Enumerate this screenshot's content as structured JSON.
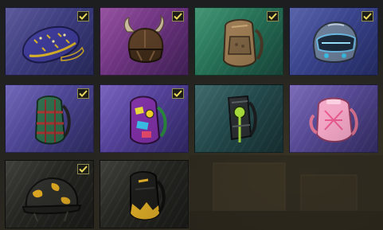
{
  "inventory": {
    "items": [
      {
        "name": "starry-cap",
        "selected": true,
        "bg": [
          "#4a4890",
          "#2d2f6a"
        ],
        "accent": "#d8b32a"
      },
      {
        "name": "horned-helmet",
        "selected": true,
        "bg": [
          "#8a3f95",
          "#4c2666"
        ],
        "accent": "#6a4a2c"
      },
      {
        "name": "tan-backpack",
        "selected": true,
        "bg": [
          "#2f8a66",
          "#1b5244"
        ],
        "accent": "#a4835a"
      },
      {
        "name": "visor-helmet",
        "selected": true,
        "bg": [
          "#4552a0",
          "#2a3274"
        ],
        "accent": "#6ab6e0"
      },
      {
        "name": "plaid-backpack",
        "selected": true,
        "bg": [
          "#6257b2",
          "#33306e"
        ],
        "accent": "#2e6b4a"
      },
      {
        "name": "sticker-backpack",
        "selected": true,
        "bg": [
          "#6a52b6",
          "#362c72"
        ],
        "accent": "#7d2fa2"
      },
      {
        "name": "frame-backpack",
        "selected": false,
        "bg": [
          "#2b5a5c",
          "#1a3639"
        ],
        "accent": "#a6d93a"
      },
      {
        "name": "pink-backpack",
        "selected": false,
        "bg": [
          "#6c5bb0",
          "#3a3270"
        ],
        "accent": "#f2a6c6"
      },
      {
        "name": "camo-helmet",
        "selected": true,
        "bg": [
          "#2a2a26",
          "#1d1d1a"
        ],
        "accent": "#d9a421"
      },
      {
        "name": "black-yellow-backpack",
        "selected": false,
        "bg": [
          "#2a2a26",
          "#1d1d1a"
        ],
        "accent": "#d7a726"
      }
    ],
    "check_color": "#e9d85c"
  }
}
